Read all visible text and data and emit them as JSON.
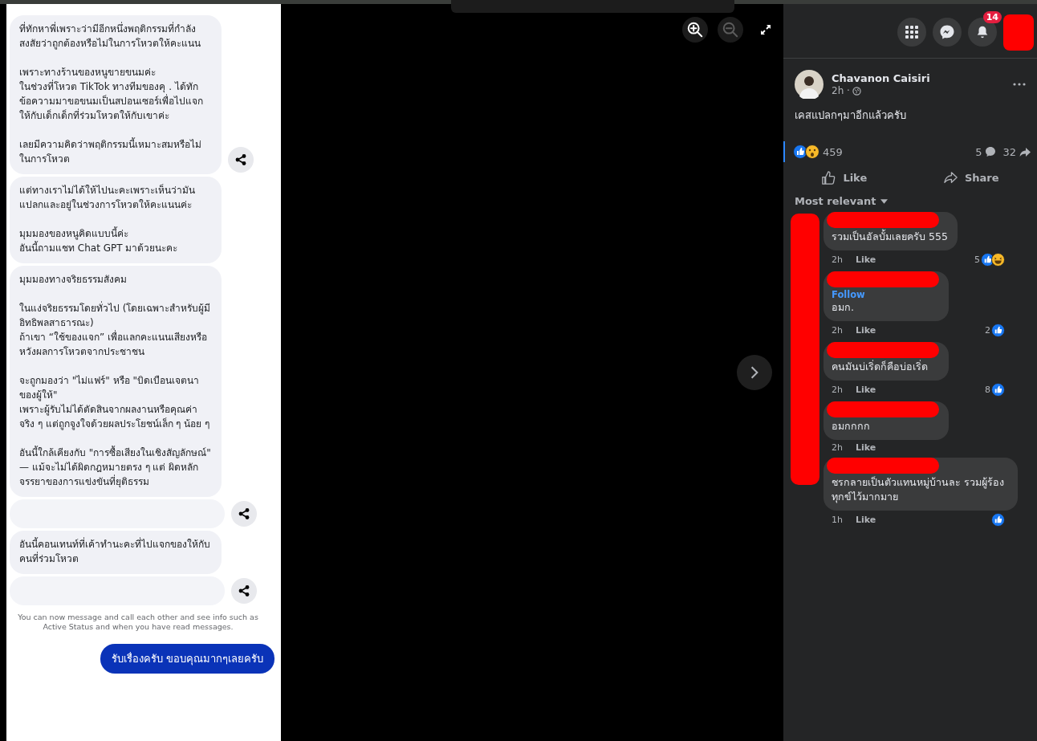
{
  "chat": {
    "messages": [
      {
        "kind": "received",
        "text": "ที่ทักหาพี่เพราะว่ามีอีกหนึ่งพฤติกรรมที่กำลังสงสัยว่าถูกต้องหรือไม่ในการโหวตให้คะแนน\n\nเพราะทางร้านของหนูขายขนมค่ะ\nในช่วงที่โหวต TikTok ทางทีมของคุ  .     ได้ทักข้อความมาขอขนมเป็นสปอนเซอร์เพื่อไปแจกให้กับเด็กเด็กที่ร่วมโหวตให้กับเขาค่ะ\n\nเลยมีความคิดว่าพฤติกรรมนี้เหมาะสมหรือไม่ในการโหวต",
        "share": true
      },
      {
        "kind": "received",
        "text": "แต่ทางเราไม่ได้ให้ไปนะคะเพราะเห็นว่ามันแปลกและอยู่ในช่วงการโหวตให้คะแนนค่ะ\n\nมุมมองของหนูคิดแบบนี้ค่ะ\nอันนี้ถามแชท Chat GPT มาด้วยนะคะ",
        "share": false
      },
      {
        "kind": "received",
        "text": "มุมมองทางจริยธรรมสังคม\n\nในแง่จริยธรรมโดยทั่วไป (โดยเฉพาะสำหรับผู้มีอิทธิพลสาธารณะ)\nถ้าเขา “ใช้ของแจก” เพื่อแลกคะแนนเสียงหรือหวังผลการโหวตจากประชาชน\n\nจะถูกมองว่า \"ไม่แฟร์\" หรือ \"บิดเบือนเจตนาของผู้ให้\"\nเพราะผู้รับไม่ได้ตัดสินจากผลงานหรือคุณค่าจริง ๆ แต่ถูกจูงใจด้วยผลประโยชน์เล็ก ๆ น้อย ๆ\n\nอันนี้ใกล้เคียงกับ \"การซื้อเสียงในเชิงสัญลักษณ์\" — แม้จะไม่ได้ผิดกฎหมายตรง ๆ แต่ ผิดหลักจรรยาของการแข่งขันที่ยุติธรรม",
        "share": false
      },
      {
        "kind": "blank",
        "share": true
      },
      {
        "kind": "received",
        "text": "อันนี้คอนเทนท์ที่เค้าทำนะคะที่ไปแจกของให้กับคนที่ร่วมโหวต",
        "share": false
      },
      {
        "kind": "blank",
        "share": true
      },
      {
        "kind": "notice",
        "text": "You can now message and call each other and see info such as Active Status and when you have read messages."
      },
      {
        "kind": "sent",
        "text": "รับเรื่องครับ ขอบคุณมากๆเลยครับ"
      }
    ]
  },
  "viewer": {
    "zoom_out_disabled": true
  },
  "header": {
    "notification_badge": "14"
  },
  "post": {
    "author": "Chavanon Caisiri",
    "time": "2h ·",
    "caption": "เคสแปลกๆมาอีกแล้วครับ",
    "reactions": [
      {
        "kind": "like"
      },
      {
        "kind": "wow"
      }
    ],
    "reaction_count": "459",
    "comment_count": "5",
    "share_count": "32",
    "actions": [
      "Like",
      "Share"
    ],
    "sort_label": "Most relevant"
  },
  "comments": [
    {
      "text": "รวมเป็นอัลบั้มเลยครับ 555",
      "time": "2h",
      "like": "Like",
      "reaction_count": "5",
      "reactions": [
        {
          "kind": "like"
        },
        {
          "kind": "haha"
        }
      ]
    },
    {
      "text": "อมก.",
      "follow": "Follow",
      "time": "2h",
      "like": "Like",
      "reaction_count": "2",
      "reactions": [
        {
          "kind": "like"
        }
      ]
    },
    {
      "text": "คนมันบ่เริ่ดก็คือบ่อเริ่ด",
      "time": "2h",
      "like": "Like",
      "reaction_count": "8",
      "reactions": [
        {
          "kind": "like"
        }
      ]
    },
    {
      "text": "อมกกกก",
      "time": "2h",
      "like": "Like"
    },
    {
      "text": "ชรกลายเป็นตัวแทนหมู่บ้านละ รวมผู้ร้องทุกข์ไว้มากมาย",
      "time": "1h",
      "like": "Like",
      "reactions": [
        {
          "kind": "like"
        }
      ]
    }
  ]
}
